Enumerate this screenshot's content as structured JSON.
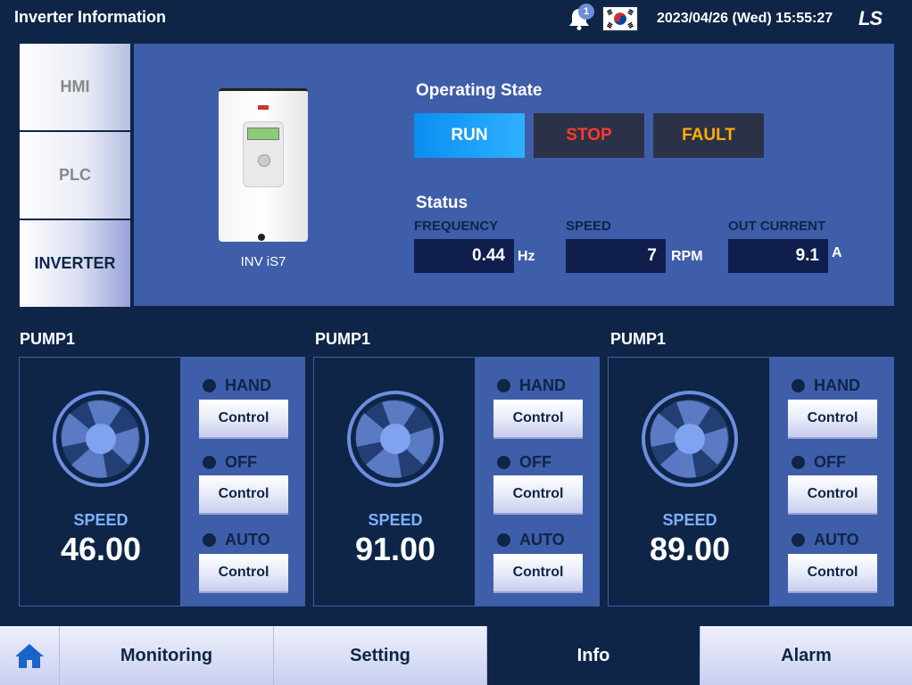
{
  "header": {
    "title": "Inverter Information",
    "notification_count": "1",
    "datetime": "2023/04/26 (Wed) 15:55:27",
    "logo": "LS"
  },
  "side_tabs": [
    {
      "label": "HMI",
      "active": false
    },
    {
      "label": "PLC",
      "active": false
    },
    {
      "label": "INVERTER",
      "active": true
    }
  ],
  "inverter": {
    "model": "INV iS7",
    "operating_state_title": "Operating State",
    "states": {
      "run": "RUN",
      "stop": "STOP",
      "fault": "FAULT"
    },
    "active_state": "RUN",
    "status_title": "Status",
    "frequency": {
      "label": "FREQUENCY",
      "value": "0.44",
      "unit": "Hz"
    },
    "speed": {
      "label": "SPEED",
      "value": "7",
      "unit": "RPM"
    },
    "current": {
      "label": "OUT CURRENT",
      "value": "9.1",
      "unit": "A"
    }
  },
  "pumps": [
    {
      "title": "PUMP1",
      "speed_label": "SPEED",
      "speed": "46.00",
      "modes": [
        {
          "label": "HAND",
          "button": "Control"
        },
        {
          "label": "OFF",
          "button": "Control"
        },
        {
          "label": "AUTO",
          "button": "Control"
        }
      ]
    },
    {
      "title": "PUMP1",
      "speed_label": "SPEED",
      "speed": "91.00",
      "modes": [
        {
          "label": "HAND",
          "button": "Control"
        },
        {
          "label": "OFF",
          "button": "Control"
        },
        {
          "label": "AUTO",
          "button": "Control"
        }
      ]
    },
    {
      "title": "PUMP1",
      "speed_label": "SPEED",
      "speed": "89.00",
      "modes": [
        {
          "label": "HAND",
          "button": "Control"
        },
        {
          "label": "OFF",
          "button": "Control"
        },
        {
          "label": "AUTO",
          "button": "Control"
        }
      ]
    }
  ],
  "footer_nav": [
    {
      "label": "Monitoring",
      "active": false
    },
    {
      "label": "Setting",
      "active": false
    },
    {
      "label": "Info",
      "active": true
    },
    {
      "label": "Alarm",
      "active": false
    }
  ],
  "colors": {
    "background": "#0e2547",
    "panel": "#3f5ea9",
    "run": "#1a9cf8",
    "stop_text": "#ff3a2f",
    "fault_text": "#ffb000"
  }
}
